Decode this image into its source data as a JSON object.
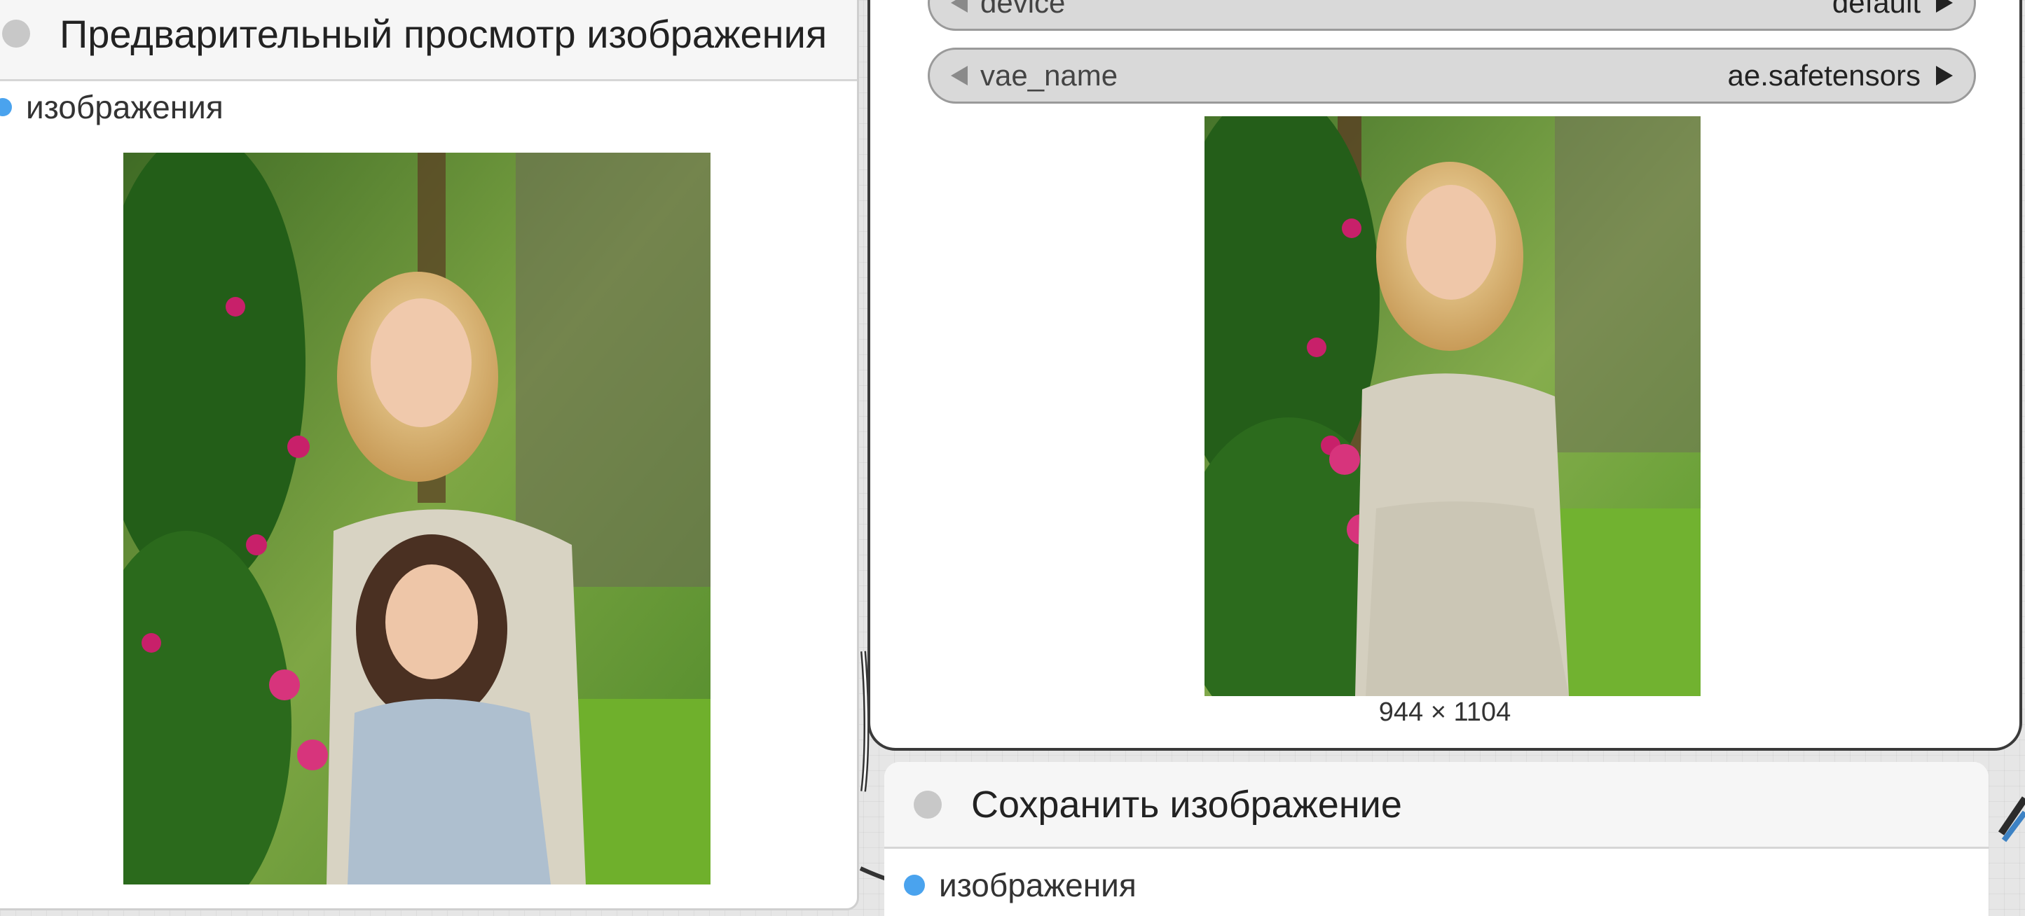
{
  "preview_node": {
    "title": "Предварительный просмотр изображения",
    "input_slot": "изображения"
  },
  "vae_node": {
    "widgets": [
      {
        "name": "device",
        "value": "default"
      },
      {
        "name": "vae_name",
        "value": "ae.safetensors"
      }
    ],
    "image_size": "944 × 1104"
  },
  "save_node": {
    "title": "Сохранить изображение",
    "input_slot": "изображения"
  },
  "colors": {
    "slot_image": "#4aa3ee",
    "link_blue": "#3d82c4",
    "status_dot": "#c8c8c8"
  },
  "icons": [
    "status-dot",
    "arrow-left-icon",
    "arrow-right-icon",
    "slot-dot"
  ]
}
